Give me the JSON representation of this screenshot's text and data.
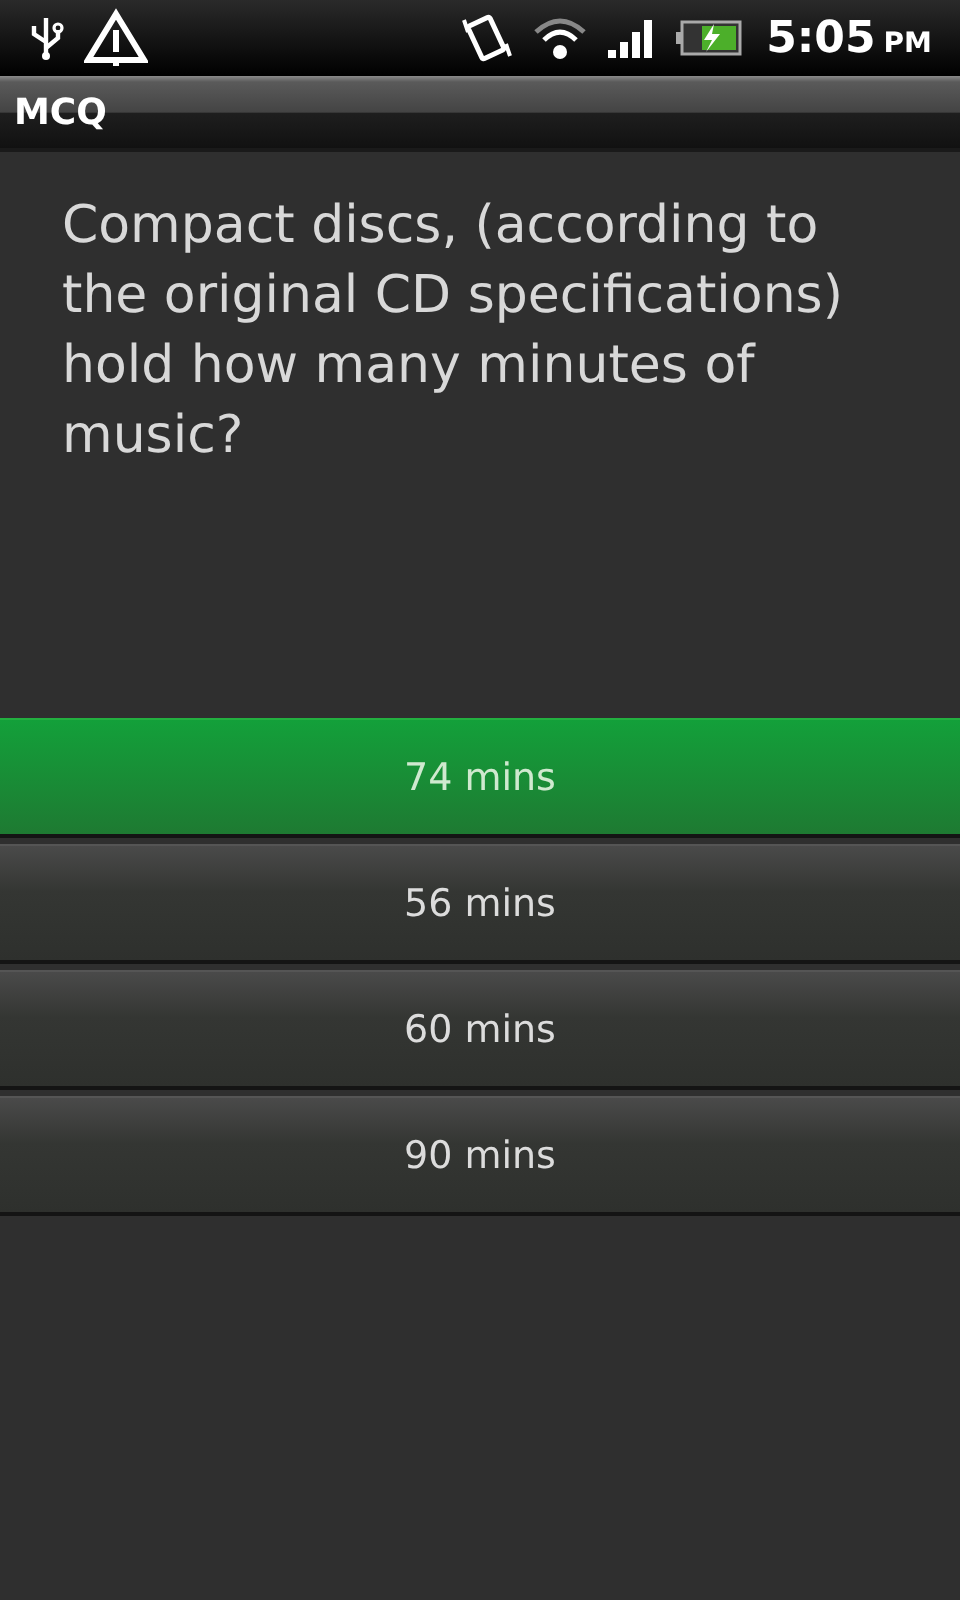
{
  "status_bar": {
    "time": "5:05",
    "period": "PM"
  },
  "app_bar": {
    "title": "MCQ"
  },
  "question": "Compact discs, (according to the original CD specifications) hold how many minutes of music?",
  "answers": [
    {
      "label": "74 mins",
      "selected": true
    },
    {
      "label": "56 mins",
      "selected": false
    },
    {
      "label": "60 mins",
      "selected": false
    },
    {
      "label": "90 mins",
      "selected": false
    }
  ]
}
